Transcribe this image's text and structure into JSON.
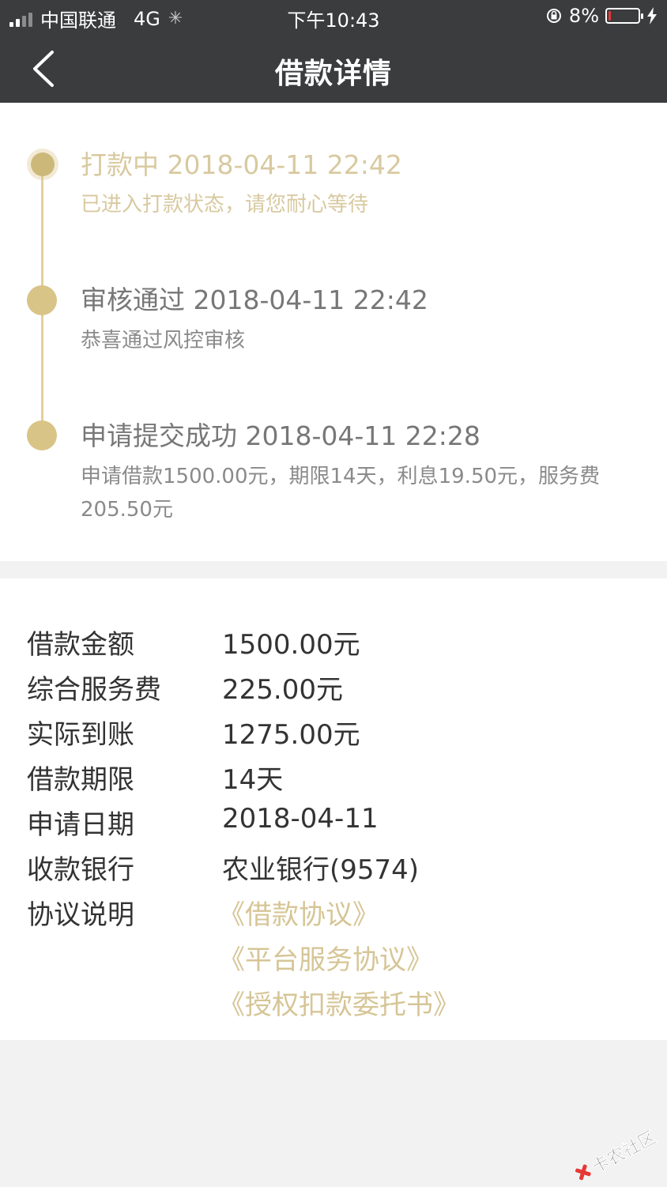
{
  "status_bar": {
    "carrier": "中国联通",
    "network": "4G",
    "time": "下午10:43",
    "battery": "8%",
    "battery_level": 0.08
  },
  "nav": {
    "title": "借款详情",
    "back_icon": "chevron-left-icon"
  },
  "timeline": [
    {
      "title": "打款中 2018-04-11 22:42",
      "desc": "已进入打款状态，请您耐心等待",
      "active": true
    },
    {
      "title": "审核通过 2018-04-11 22:42",
      "desc": "恭喜通过风控审核",
      "active": false
    },
    {
      "title": "申请提交成功 2018-04-11 22:28",
      "desc": "申请借款1500.00元，期限14天，利息19.50元，服务费205.50元",
      "active": false
    }
  ],
  "details": [
    {
      "label": "借款金额",
      "value": "1500.00元"
    },
    {
      "label": "综合服务费",
      "value": "225.00元"
    },
    {
      "label": "实际到账",
      "value": "1275.00元"
    },
    {
      "label": "借款期限",
      "value": "14天"
    },
    {
      "label": "申请日期",
      "value": "2018-04-11"
    },
    {
      "label": "收款银行",
      "value": "农业银行(9574)"
    }
  ],
  "agreements": {
    "label": "协议说明",
    "links": [
      "《借款协议》",
      "《平台服务协议》",
      "《授权扣款委托书》"
    ]
  },
  "watermark": {
    "text": "卡农社区"
  },
  "colors": {
    "header_bg": "#3a3c3e",
    "accent_gold": "#d9c487",
    "link_gold": "#d6c596",
    "battery_low": "#e53935"
  }
}
